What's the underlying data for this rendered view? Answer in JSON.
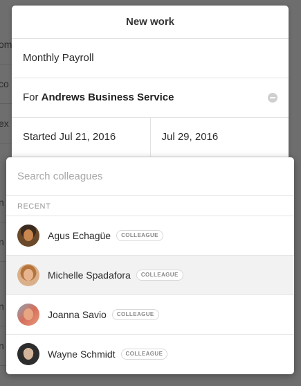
{
  "background": {
    "rows": [
      "om",
      "co",
      "ex",
      "n",
      "n",
      "n",
      "n"
    ]
  },
  "new_work": {
    "title": "New work",
    "job_name": "Monthly Payroll",
    "client_prefix": "For",
    "client_name": "Andrews Business Service",
    "start_label": "Started Jul 21, 2016",
    "due_date": "Jul 29, 2016"
  },
  "picker": {
    "search_placeholder": "Search colleagues",
    "section_label": "RECENT",
    "people": [
      {
        "name": "Agus Echagüe",
        "badge": "COLLEAGUE"
      },
      {
        "name": "Michelle Spadafora",
        "badge": "COLLEAGUE"
      },
      {
        "name": "Joanna Savio",
        "badge": "COLLEAGUE"
      },
      {
        "name": "Wayne Schmidt",
        "badge": "COLLEAGUE"
      }
    ]
  },
  "colors": {
    "overlay": "#6e6e6e",
    "highlight_row": "#f2f2f2",
    "placeholder": "#a8a8a8"
  }
}
